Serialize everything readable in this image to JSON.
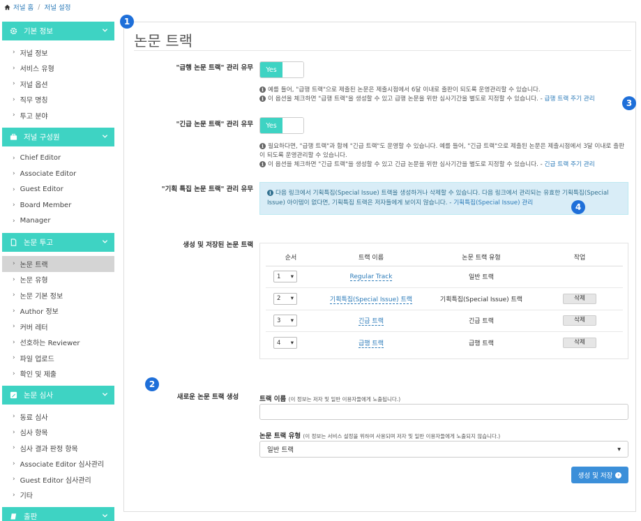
{
  "breadcrumb": {
    "home": "저널 홈",
    "current": "저널 설정"
  },
  "sidebar": {
    "groups": [
      {
        "title": "기본 정보",
        "items": [
          "저널 정보",
          "서비스 유형",
          "저널 옵션",
          "직무 명칭",
          "투고 분야"
        ]
      },
      {
        "title": "저널 구성원",
        "items": [
          "Chief Editor",
          "Associate Editor",
          "Guest Editor",
          "Board Member",
          "Manager"
        ]
      },
      {
        "title": "논문 투고",
        "items": [
          "논문 트랙",
          "논문 유형",
          "논문 기본 정보",
          "Author 정보",
          "커버 레터",
          "선호하는 Reviewer",
          "파일 업로드",
          "확인 및 제출"
        ]
      },
      {
        "title": "논문 심사",
        "items": [
          "동료 심사",
          "심사 항목",
          "심사 결과 판정 항목",
          "Associate Editor 심사관리",
          "Guest Editor 심사관리",
          "기타"
        ]
      },
      {
        "title": "출판",
        "items": []
      }
    ]
  },
  "main": {
    "title": "논문 트랙",
    "rapid": {
      "label": "\"급행 논문 트랙\" 관리 유무",
      "toggle": "Yes",
      "help1": "예를 들어, \"급행 트랙\"으로 제출된 논문은 제출시점에서 6달 이내로 출판이 되도록 운영관리할 수 있습니다.",
      "help2": "이 옵션을 체크하면 \"급행 트랙\"을 생성할 수 있고 급행 논문을 위한 심사기간을 별도로 지정할 수 있습니다. -",
      "link": "급행 트랙 주기 관리"
    },
    "urgent": {
      "label": "\"긴급 논문 트랙\" 관리 유무",
      "toggle": "Yes",
      "help1": "필요하다면, \"급행 트랙\"과 함께 \"긴급 트랙\"도 운영할 수 있습니다. 예를 들어, \"긴급 트랙\"으로 제출된 논문은 제출시점에서 3달 이내로 출판이 되도록 운영관리할 수 있습니다.",
      "help2": "이 옵션을 체크하면 \"긴급 트랙\"을 생성할 수 있고 긴급 논문을 위한 심사기간을 별도로 지정할 수 있습니다. -",
      "link": "긴급 트랙 주기 관리"
    },
    "special": {
      "label": "\"기획 특집 논문 트랙\" 관리 유무",
      "info": "다음 링크에서 기획특집(Special Issue) 트랙을 생성하거나 삭제할 수 있습니다. 다음 링크에서 관리되는 유효한 기획특집(Special Issue) 아이템이 없다면, 기획특집 트랙은 저자들에게 보이지 않습니다. -",
      "link": "기획특집(Special Issue) 관리"
    },
    "tracks": {
      "label": "생성 및 저장된 논문 트랙",
      "headers": [
        "순서",
        "트랙 이름",
        "논문 트랙 유형",
        "작업"
      ],
      "rows": [
        {
          "order": "1",
          "name": "Regular Track",
          "type": "일반 트랙",
          "action": ""
        },
        {
          "order": "2",
          "name": "기획특집(Special Issue) 트랙",
          "type": "기획특집(Special Issue) 트랙",
          "action": "삭제"
        },
        {
          "order": "3",
          "name": "긴급 트랙",
          "type": "긴급 트랙",
          "action": "삭제"
        },
        {
          "order": "4",
          "name": "급행 트랙",
          "type": "급행 트랙",
          "action": "삭제"
        }
      ]
    },
    "create": {
      "label": "새로운 논문 트랙 생성",
      "name_label": "트랙 이름",
      "name_hint": "(이 정보는 저자 및 일반 이용자들에게 노출됩니다.)",
      "name_value": "",
      "type_label": "논문 트랙 유형",
      "type_hint": "(이 정보는 서비스 설정을 위하여 사용되며 저자 및 일반 이용자들에게 노출되지 않습니다.)",
      "type_value": "일반 트랙",
      "button": "생성 및 저장"
    }
  },
  "badges": [
    "1",
    "2",
    "3",
    "4"
  ],
  "colors": {
    "accent": "#3ed3c3",
    "link": "#2a7ab8",
    "primary_button": "#3b8fd9",
    "badge": "#1e6fd9",
    "info_bg": "#d9edf7"
  }
}
